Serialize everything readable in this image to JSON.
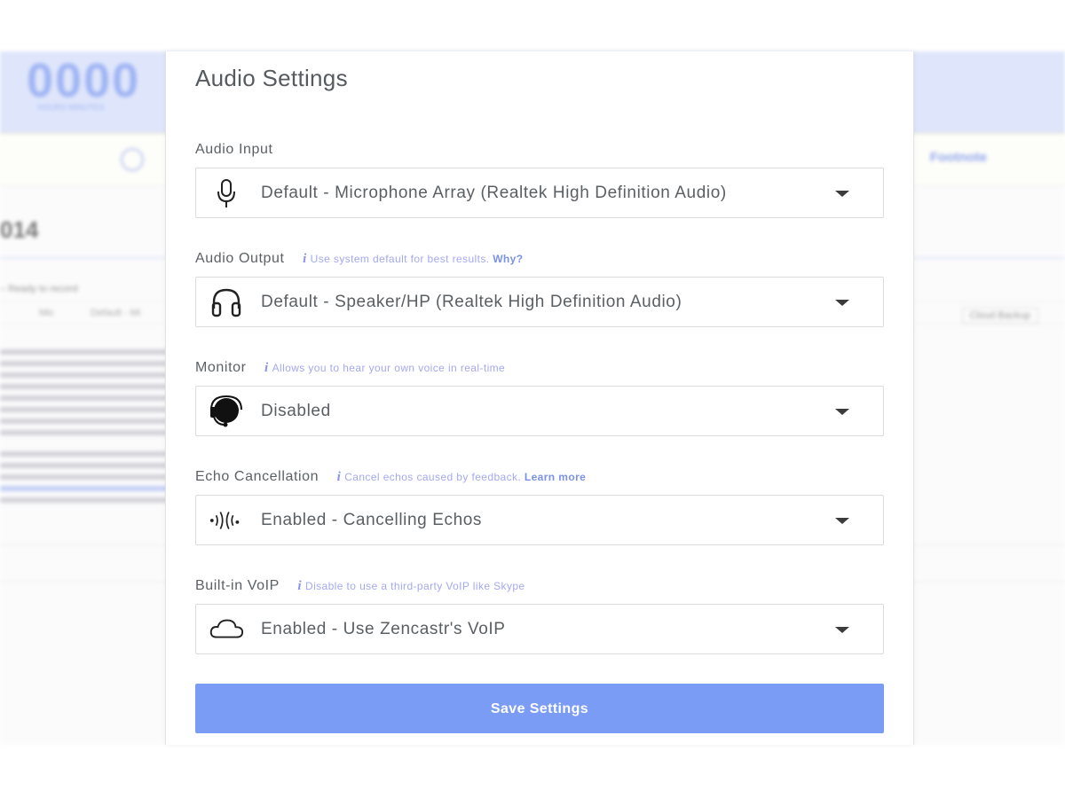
{
  "background": {
    "timer_hours": "00",
    "timer_minutes": "00",
    "timer_labels": "HOURS      MINUTES",
    "toolbar_right": "Footnote",
    "number": "014",
    "status": "– Ready to record",
    "row_mic": "Mic",
    "row_default": "Default - Mi",
    "row_backup": "Cloud Backup"
  },
  "modal": {
    "title": "Audio Settings",
    "fields": [
      {
        "label": "Audio Input",
        "hint": "",
        "hint_link": "",
        "icon": "microphone-icon",
        "value": "Default - Microphone Array (Realtek High Definition Audio)"
      },
      {
        "label": "Audio Output",
        "hint": "Use system default for best results.",
        "hint_link": "Why?",
        "icon": "headphones-icon",
        "value": "Default - Speaker/HP (Realtek High Definition Audio)"
      },
      {
        "label": "Monitor",
        "hint": "Allows you to hear your own voice in real-time",
        "hint_link": "",
        "icon": "headset-icon",
        "value": "Disabled"
      },
      {
        "label": "Echo Cancellation",
        "hint": "Cancel echos caused by feedback.",
        "hint_link": "Learn more",
        "icon": "echo-waves-icon",
        "value": "Enabled - Cancelling Echos"
      },
      {
        "label": "Built-in VoIP",
        "hint": "Disable to use a third-party VoIP like Skype",
        "hint_link": "",
        "icon": "cloud-icon",
        "value": "Enabled - Use Zencastr's VoIP"
      }
    ],
    "info_glyph": "i",
    "save_label": "Save Settings"
  },
  "colors": {
    "accent": "#7b9cf5",
    "hint": "#a4a9f0",
    "hint_link": "#7a91e8",
    "text": "#5a5f64"
  }
}
